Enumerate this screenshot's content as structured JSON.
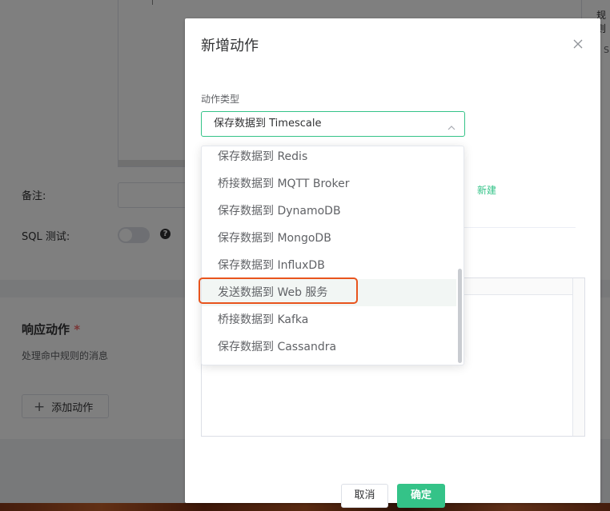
{
  "background": {
    "note_label": "备注:",
    "sql_test_label": "SQL 测试:",
    "help_icon_glyph": "?",
    "section_title": "响应动作",
    "required_mark": "*",
    "section_desc": "处理命中规则的消息",
    "add_action_button": "添加动作",
    "add_icon_glyph": "+",
    "right_cut_text": "规则",
    "right_cut_text2": "S"
  },
  "dialog": {
    "title": "新增动作",
    "action_type_label": "动作类型",
    "selected_value": "保存数据到 Timescale",
    "new_link": "新建",
    "cancel_button": "取消",
    "ok_button": "确定"
  },
  "dropdown": {
    "items": [
      "保存数据到 Redis",
      "桥接数据到 MQTT Broker",
      "保存数据到 DynamoDB",
      "保存数据到 MongoDB",
      "保存数据到 InfluxDB",
      "发送数据到 Web 服务",
      "桥接数据到 Kafka",
      "保存数据到 Cassandra"
    ],
    "highlighted_index": 5
  },
  "colors": {
    "accent": "#34c388",
    "highlight_border": "#e8541d",
    "required": "#f56c6c"
  }
}
